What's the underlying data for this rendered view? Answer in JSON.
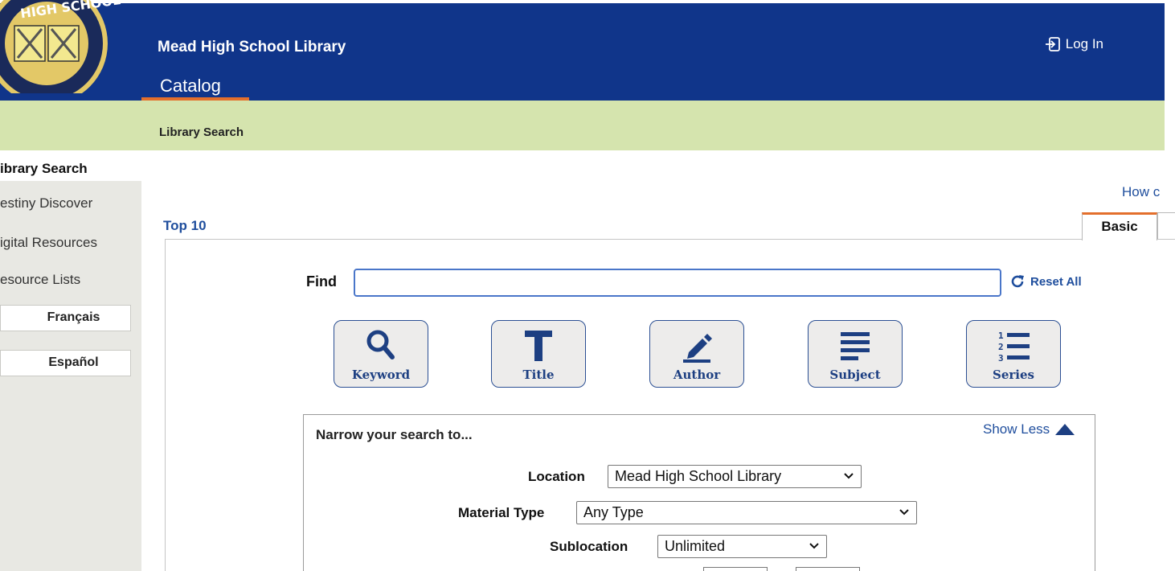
{
  "header": {
    "site_title": "Mead High School Library",
    "catalog_tab": "Catalog",
    "login_label": "Log In",
    "logo_text": "HIGH SCHOOL",
    "bg_color": "#10358a",
    "accent_color": "#e36f2c"
  },
  "breadcrumb": {
    "current": "Library Search"
  },
  "sidebar": {
    "items": [
      {
        "label": "ibrary Search"
      },
      {
        "label": "estiny Discover"
      },
      {
        "label": "igital Resources"
      },
      {
        "label": "esource Lists"
      }
    ],
    "languages": [
      {
        "label": "Français"
      },
      {
        "label": "Español"
      }
    ]
  },
  "main": {
    "howto_link": "How c",
    "top10_link": "Top 10",
    "tabs": [
      {
        "label": "Basic"
      }
    ],
    "find_label": "Find",
    "find_value": "",
    "reset_label": "Reset All",
    "search_buttons": [
      {
        "label": "Keyword",
        "icon": "magnifier-icon"
      },
      {
        "label": "Title",
        "icon": "title-t-icon"
      },
      {
        "label": "Author",
        "icon": "pen-icon"
      },
      {
        "label": "Subject",
        "icon": "lines-icon"
      },
      {
        "label": "Series",
        "icon": "numbered-list-icon"
      }
    ]
  },
  "narrow": {
    "title": "Narrow your search to...",
    "show_less_label": "Show Less",
    "fields": [
      {
        "label": "Location",
        "value": "Mead High School Library"
      },
      {
        "label": "Material Type",
        "value": "Any Type"
      },
      {
        "label": "Sublocation",
        "value": "Unlimited"
      }
    ]
  }
}
